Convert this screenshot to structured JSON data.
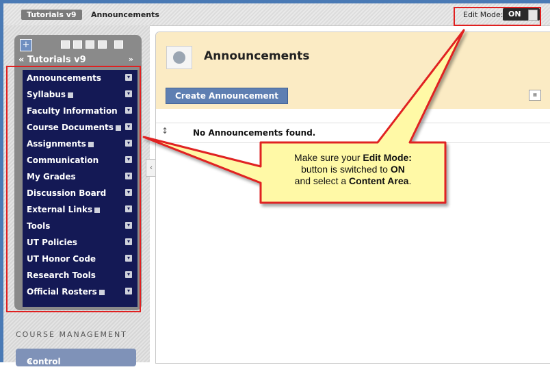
{
  "breadcrumb": {
    "course": "Tutorials v9",
    "page": "Announcements"
  },
  "edit_mode": {
    "label": "Edit Mode:",
    "state": "ON"
  },
  "sidebar": {
    "course_title": "Tutorials v9",
    "menu_items": [
      {
        "label": "Announcements"
      },
      {
        "label": "Syllabus"
      },
      {
        "label": "Faculty Information"
      },
      {
        "label": "Course Documents"
      },
      {
        "label": "Assignments"
      },
      {
        "label": "Communication"
      },
      {
        "label": "My Grades"
      },
      {
        "label": "Discussion Board"
      },
      {
        "label": "External Links"
      },
      {
        "label": "Tools"
      },
      {
        "label": "UT Policies"
      },
      {
        "label": "UT Honor Code"
      },
      {
        "label": "Research Tools"
      },
      {
        "label": "Official Rosters"
      }
    ],
    "management_heading": "COURSE MANAGEMENT",
    "control_panel": "Control Panel"
  },
  "content": {
    "title": "Announcements",
    "create_button": "Create Announcement",
    "empty_message": "No Announcements found."
  },
  "callout": {
    "line1_pre": "Make sure your ",
    "line1_bold": "Edit Mode:",
    "line2_pre": "button is switched to ",
    "line2_bold": "ON",
    "line3_pre": "and select a ",
    "line3_bold": "Content Area",
    "line3_post": "."
  },
  "colors": {
    "menu_bg": "#141955",
    "highlight": "#e02020",
    "header_bg": "#fbebc4",
    "callout_fill": "#fff9a6"
  },
  "icons": [
    "plus-icon",
    "speaker-icon",
    "chevron-icon",
    "reorder-icon",
    "collapse-icon"
  ]
}
